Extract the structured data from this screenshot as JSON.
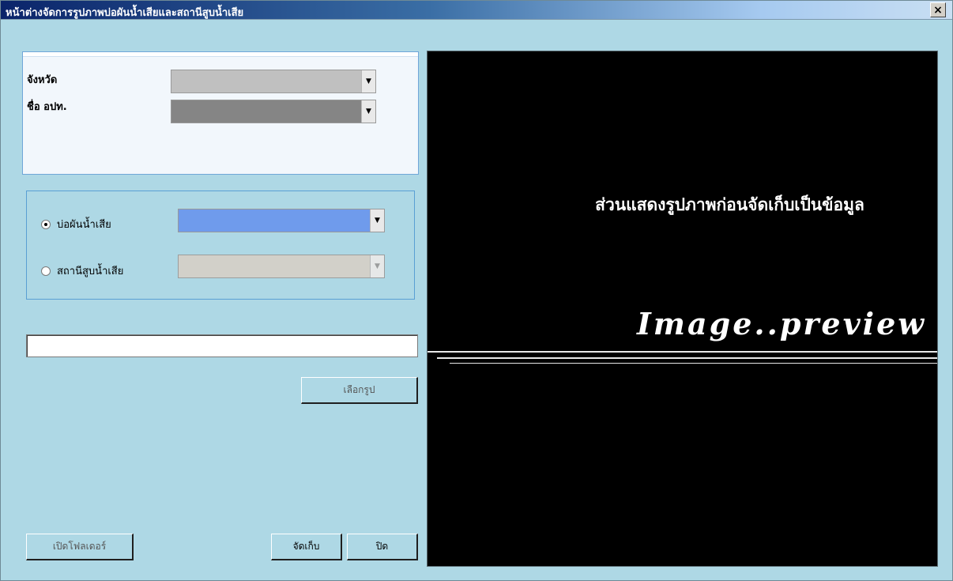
{
  "window": {
    "title": "หน้าต่างจัดการรูปภาพบ่อผันน้ำเสียและสถานีสูบน้ำเสีย",
    "close_glyph": "×"
  },
  "location_panel": {
    "province_label": "จังหวัด",
    "province_value": "",
    "lao_label": "ชื่อ อปท.",
    "lao_value": ""
  },
  "type_panel": {
    "options": [
      {
        "label": "บ่อผันน้ำเสีย",
        "checked": true,
        "value": ""
      },
      {
        "label": "สถานีสูบน้ำเสีย",
        "checked": false,
        "value": ""
      }
    ]
  },
  "file_path": "",
  "buttons": {
    "select_image": "เลือกรูป",
    "open_folder": "เปิดโฟลเดอร์",
    "save": "จัดเก็บ",
    "close": "ปิด"
  },
  "preview": {
    "caption": "ส่วนแสดงรูปภาพก่อนจัดเก็บเป็นข้อมูล",
    "watermark": "Image..preview"
  },
  "colors": {
    "window_bg": "#aed8e5",
    "preview_bg": "#000000",
    "selected_combo": "#6f9bec",
    "province_combo": "#c0c0c0",
    "lao_combo": "#858585",
    "disabled_combo": "#d4d0c8"
  }
}
